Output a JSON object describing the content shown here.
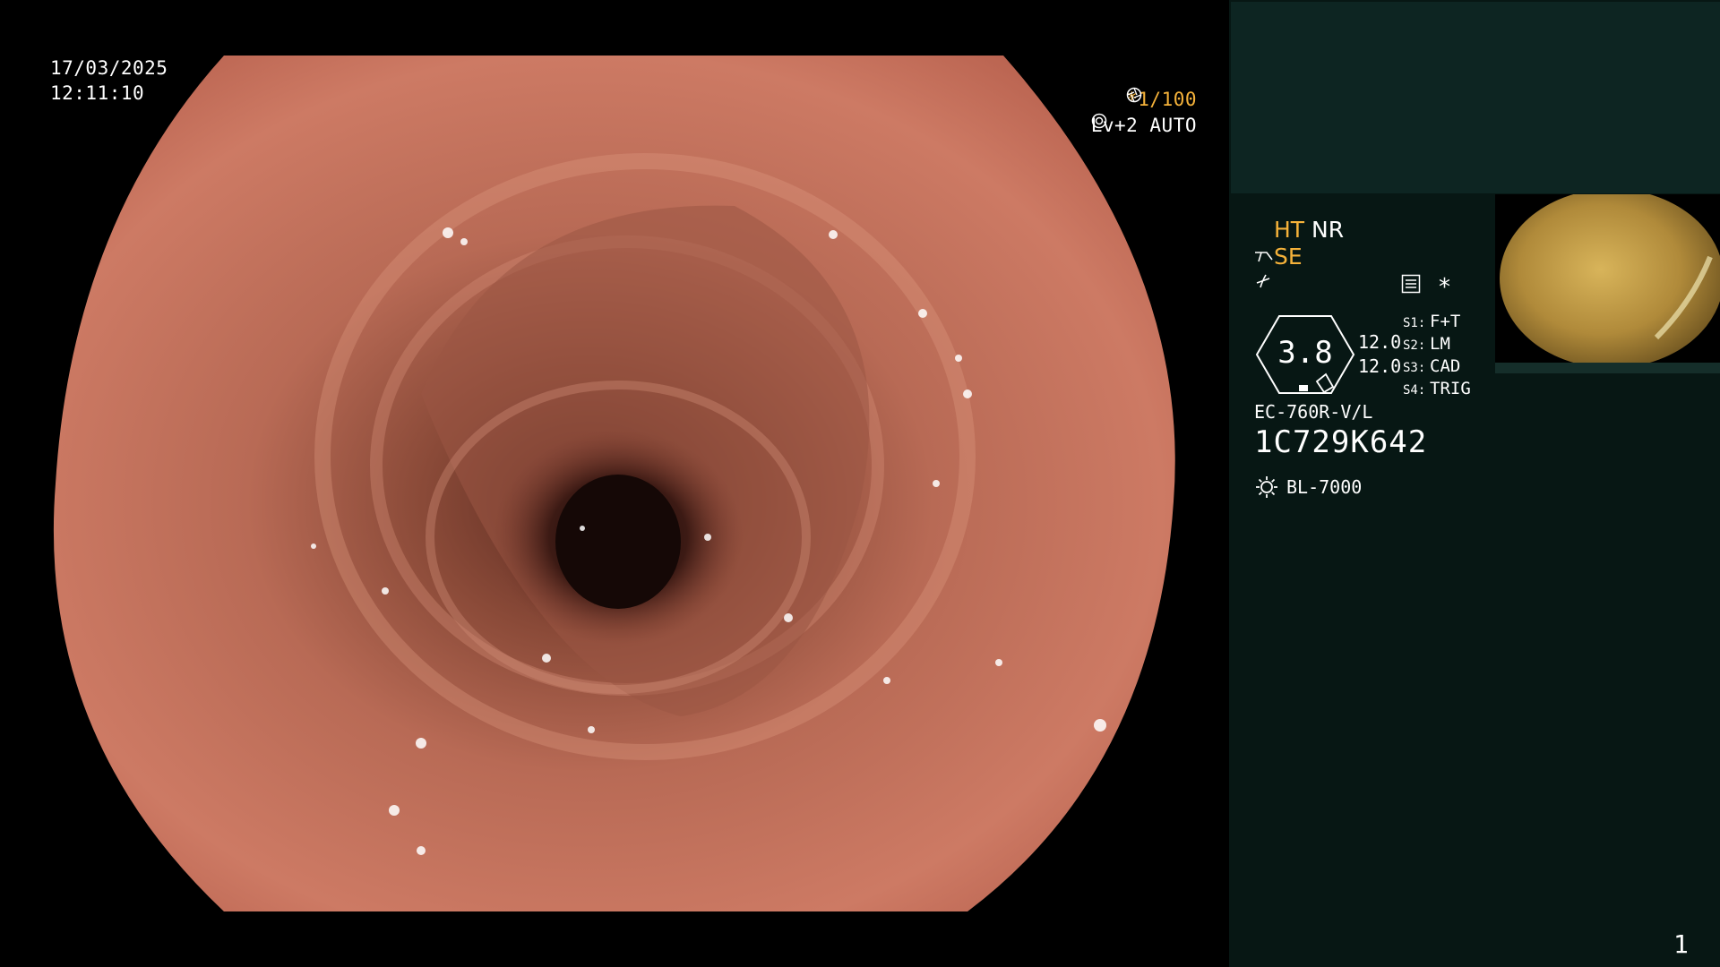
{
  "osd": {
    "date": "17/03/2025",
    "time": "12:11:10",
    "shutter": "*1/100",
    "level": "Lv+2 AUTO"
  },
  "panel": {
    "ht": "HT",
    "nr": "NR",
    "se": "SE",
    "zoom_value": "3.8",
    "zoom_a": "12.0",
    "zoom_b": "12.0",
    "switches": [
      {
        "key": "S1:",
        "value": "F+T"
      },
      {
        "key": "S2:",
        "value": "LM"
      },
      {
        "key": "S3:",
        "value": "CAD"
      },
      {
        "key": "S4:",
        "value": "TRIG"
      }
    ],
    "model": "EC-760R-V/L",
    "serial": "1C729K642",
    "light_source": "BL-7000",
    "star": "*",
    "page": "1"
  },
  "colors": {
    "accent_orange": "#f5b23a",
    "panel_bg": "#071714",
    "panel_top_bg": "#0d2522",
    "mucosa": "#c8725e"
  },
  "icons": {
    "shutter": "aperture-icon",
    "auto": "auto-exposure-icon",
    "scope": "scope-tip-icon",
    "af": "autofocus-icon",
    "menu": "list-menu-icon",
    "light": "light-source-sun-icon"
  }
}
